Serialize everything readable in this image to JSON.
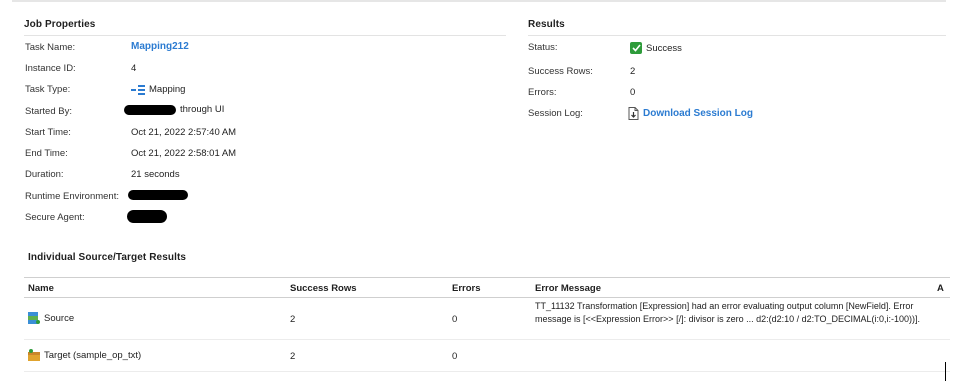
{
  "job_properties": {
    "title": "Job Properties",
    "fields": [
      {
        "label": "Task Name:",
        "value": "Mapping212"
      },
      {
        "label": "Instance ID:",
        "value": "4"
      },
      {
        "label": "Task Type:",
        "value": "Mapping"
      },
      {
        "label": "Started By:",
        "value": "through UI"
      },
      {
        "label": "Start Time:",
        "value": "Oct 21, 2022 2:57:40 AM"
      },
      {
        "label": "End Time:",
        "value": "Oct 21, 2022 2:58:01 AM"
      },
      {
        "label": "Duration:",
        "value": "21 seconds"
      },
      {
        "label": "Runtime Environment:",
        "value": ""
      },
      {
        "label": "Secure Agent:",
        "value": ""
      }
    ]
  },
  "results": {
    "title": "Results",
    "status_label": "Status:",
    "status_value": "Success",
    "success_rows_label": "Success Rows:",
    "success_rows_value": "2",
    "errors_label": "Errors:",
    "errors_value": "0",
    "session_log_label": "Session Log:",
    "session_log_link": "Download Session Log"
  },
  "individual_results": {
    "title": "Individual Source/Target Results",
    "columns": [
      "Name",
      "Success Rows",
      "Errors",
      "Error Message",
      "A"
    ],
    "rows": [
      {
        "name": "Source",
        "success_rows": "2",
        "errors": "0",
        "error_message": "TT_11132 Transformation [Expression] had an error evaluating output column [NewField]. Error message is [<<Expression Error>> [/]: divisor is zero ... d2:(d2:10 / d2:TO_DECIMAL(i:0,i:-100))].",
        "icon": "source-icon"
      },
      {
        "name": "Target (sample_op_txt)",
        "success_rows": "2",
        "errors": "0",
        "error_message": "",
        "icon": "target-icon"
      }
    ]
  },
  "colors": {
    "link": "#2b7bd1",
    "success": "#2e9b3a"
  }
}
